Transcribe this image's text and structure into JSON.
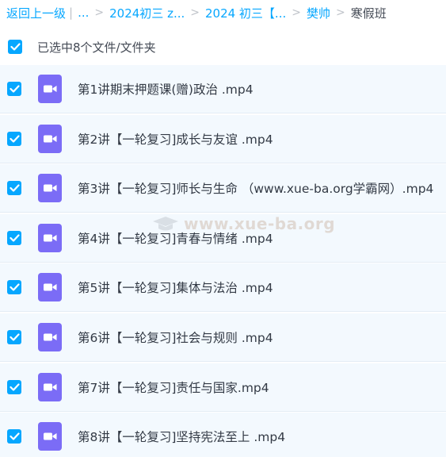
{
  "breadcrumb": {
    "back": "返回上一级",
    "ellipsis": "...",
    "items": [
      "2024初三 z...",
      "2024 初三【...",
      "樊帅"
    ],
    "current": "寒假班"
  },
  "selection": {
    "label": "已选中8个文件/文件夹",
    "checked": true
  },
  "files": [
    {
      "name": "第1讲期末押题课(赠)政治 .mp4",
      "checked": true,
      "icon": "video-file-icon"
    },
    {
      "name": "第2讲【一轮复习]成长与友谊 .mp4",
      "checked": true,
      "icon": "video-file-icon"
    },
    {
      "name": "第3讲【一轮复习]师长与生命 （www.xue-ba.org学霸网）.mp4",
      "checked": true,
      "icon": "video-file-icon"
    },
    {
      "name": "第4讲【一轮复习]青春与情绪 .mp4",
      "checked": true,
      "icon": "video-file-icon"
    },
    {
      "name": "第5讲【一轮复习]集体与法治 .mp4",
      "checked": true,
      "icon": "video-file-icon"
    },
    {
      "name": "第6讲【一轮复习]社会与规则 .mp4",
      "checked": true,
      "icon": "video-file-icon"
    },
    {
      "name": "第7讲【一轮复习]责任与国家.mp4",
      "checked": true,
      "icon": "video-file-icon"
    },
    {
      "name": "第8讲【一轮复习]坚持宪法至上 .mp4",
      "checked": true,
      "icon": "video-file-icon"
    }
  ],
  "watermark": "www.xue-ba.org",
  "colors": {
    "accent": "#06a7ff",
    "video_icon": "#7b6cf6",
    "row_bg": "#f3f9fe"
  }
}
